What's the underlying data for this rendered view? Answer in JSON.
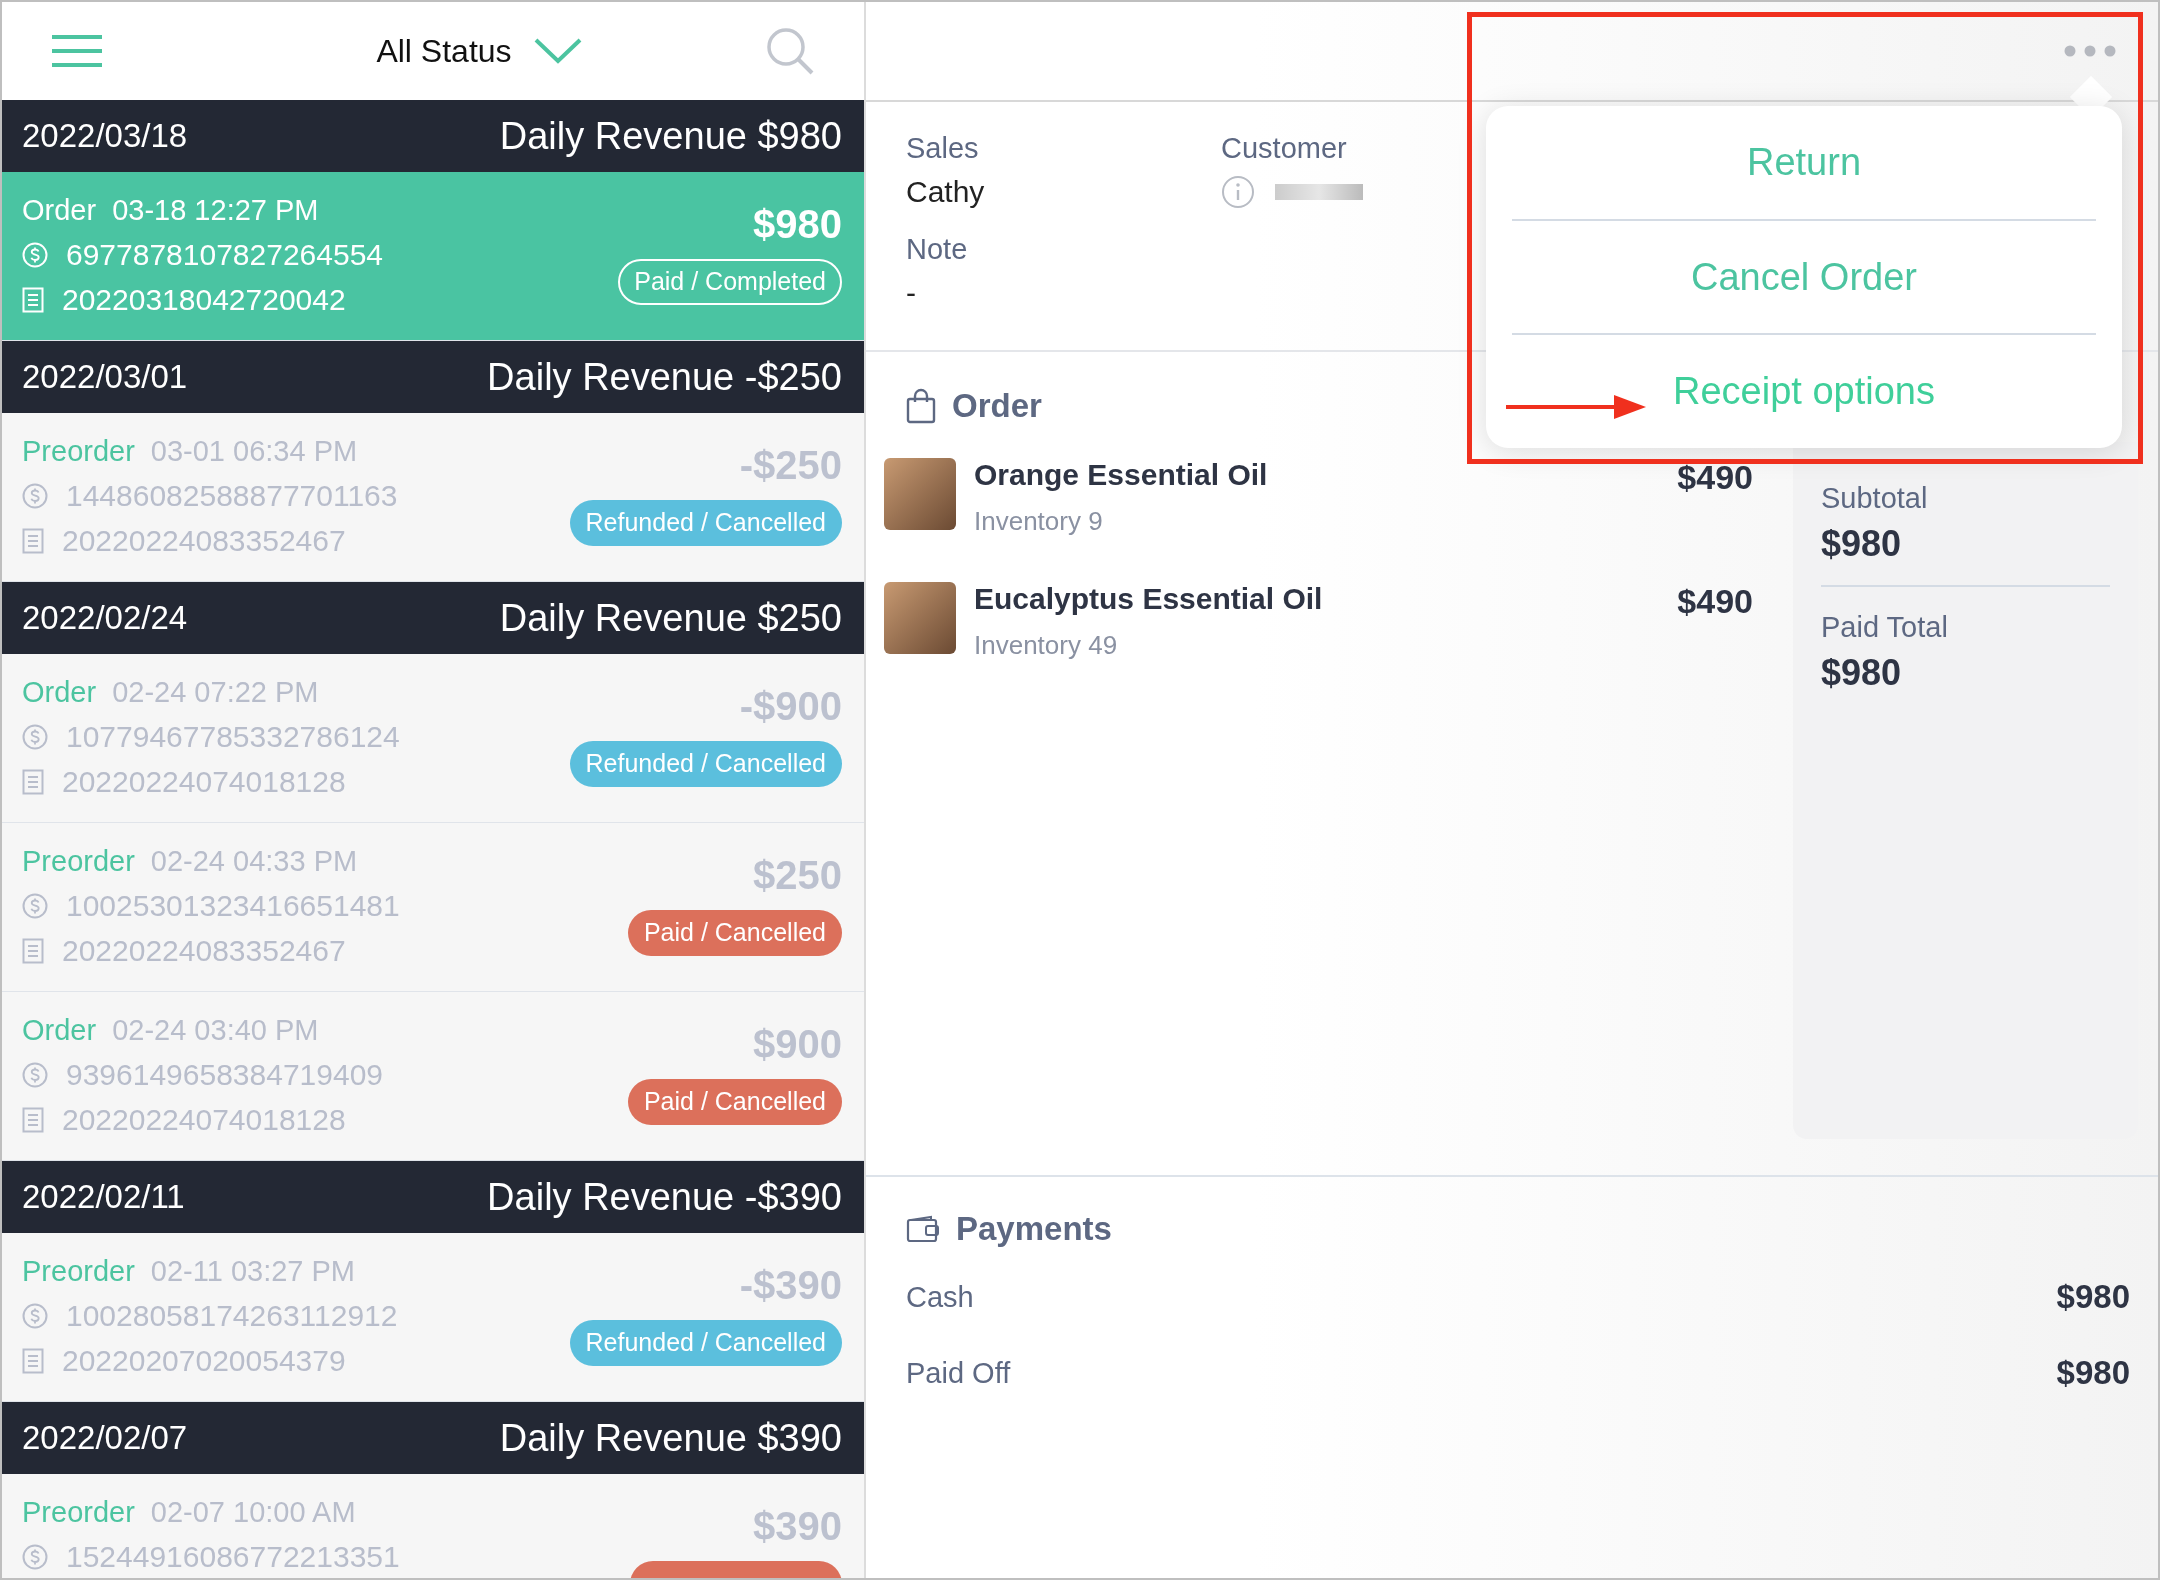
{
  "header": {
    "filter_label": "All Status"
  },
  "days": [
    {
      "date": "2022/03/18",
      "revenue": "Daily Revenue $980",
      "orders": [
        {
          "type": "Order",
          "time": "03-18 12:27 PM",
          "payment_id": "6977878107827264554",
          "receipt_no": "20220318042720042",
          "amount": "$980",
          "kind": "completed",
          "status_label": "Paid / Completed",
          "selected": true
        }
      ]
    },
    {
      "date": "2022/03/01",
      "revenue": "Daily Revenue -$250",
      "orders": [
        {
          "type": "Preorder",
          "time": "03-01 06:34 PM",
          "payment_id": "14486082588877701163",
          "receipt_no": "20220224083352467",
          "amount": "-$250",
          "kind": "refunded",
          "status_label": "Refunded / Cancelled",
          "selected": false
        }
      ]
    },
    {
      "date": "2022/02/24",
      "revenue": "Daily Revenue $250",
      "orders": [
        {
          "type": "Order",
          "time": "02-24 07:22 PM",
          "payment_id": "10779467785332786124",
          "receipt_no": "20220224074018128",
          "amount": "-$900",
          "kind": "refunded",
          "status_label": "Refunded / Cancelled",
          "selected": false
        },
        {
          "type": "Preorder",
          "time": "02-24 04:33 PM",
          "payment_id": "10025301323416651481",
          "receipt_no": "20220224083352467",
          "amount": "$250",
          "kind": "cancelled",
          "status_label": "Paid / Cancelled",
          "selected": false
        },
        {
          "type": "Order",
          "time": "02-24 03:40 PM",
          "payment_id": "9396149658384719409",
          "receipt_no": "20220224074018128",
          "amount": "$900",
          "kind": "cancelled",
          "status_label": "Paid / Cancelled",
          "selected": false
        }
      ]
    },
    {
      "date": "2022/02/11",
      "revenue": "Daily Revenue -$390",
      "orders": [
        {
          "type": "Preorder",
          "time": "02-11 03:27 PM",
          "payment_id": "10028058174263112912",
          "receipt_no": "20220207020054379",
          "amount": "-$390",
          "kind": "refunded",
          "status_label": "Refunded / Cancelled",
          "selected": false
        }
      ]
    },
    {
      "date": "2022/02/07",
      "revenue": "Daily Revenue $390",
      "orders": [
        {
          "type": "Preorder",
          "time": "02-07 10:00 AM",
          "payment_id": "15244916086772213351",
          "amount": "$390",
          "kind": "cancelled",
          "selected": false
        }
      ]
    }
  ],
  "detail": {
    "sales_label": "Sales",
    "sales_value": "Cathy",
    "customer_label": "Customer",
    "note_label": "Note",
    "note_value": "-",
    "order_heading": "Order",
    "items": [
      {
        "name": "Orange Essential Oil",
        "inventory": "Inventory 9",
        "price": "$490"
      },
      {
        "name": "Eucalyptus Essential Oil",
        "inventory": "Inventory 49",
        "price": "$490"
      }
    ],
    "summary": [
      {
        "label": "Subtotal",
        "value": "$980"
      },
      {
        "label": "Paid Total",
        "value": "$980"
      }
    ],
    "payments_heading": "Payments",
    "payments": [
      {
        "label": "Cash",
        "value": "$980"
      },
      {
        "label": "Paid Off",
        "value": "$980"
      }
    ]
  },
  "menu": {
    "items": [
      {
        "label": "Return",
        "highlighted": false
      },
      {
        "label": "Cancel Order",
        "highlighted": false
      },
      {
        "label": "Receipt options",
        "highlighted": true
      }
    ]
  }
}
